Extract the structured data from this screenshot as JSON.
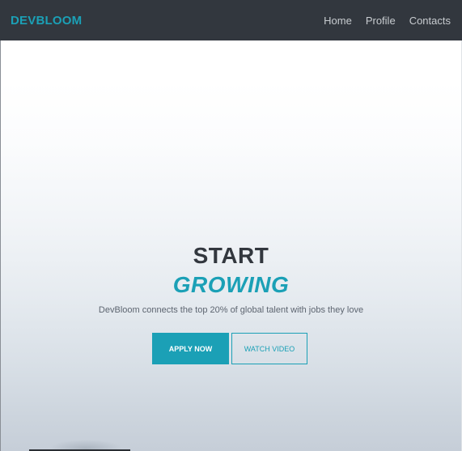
{
  "navbar": {
    "brand": "DEVBLOOM",
    "links": [
      "Home",
      "Profile",
      "Contacts"
    ]
  },
  "hero": {
    "headline_line1": "START",
    "headline_line2": "GROWING",
    "tagline": "DevBloom connects the top 20% of global talent with jobs they love",
    "primary_button": "APPLY NOW",
    "secondary_button": "WATCH VIDEO"
  },
  "colors": {
    "accent": "#1ba0b6",
    "navbar_bg": "#32373e",
    "heading": "#32373e"
  }
}
